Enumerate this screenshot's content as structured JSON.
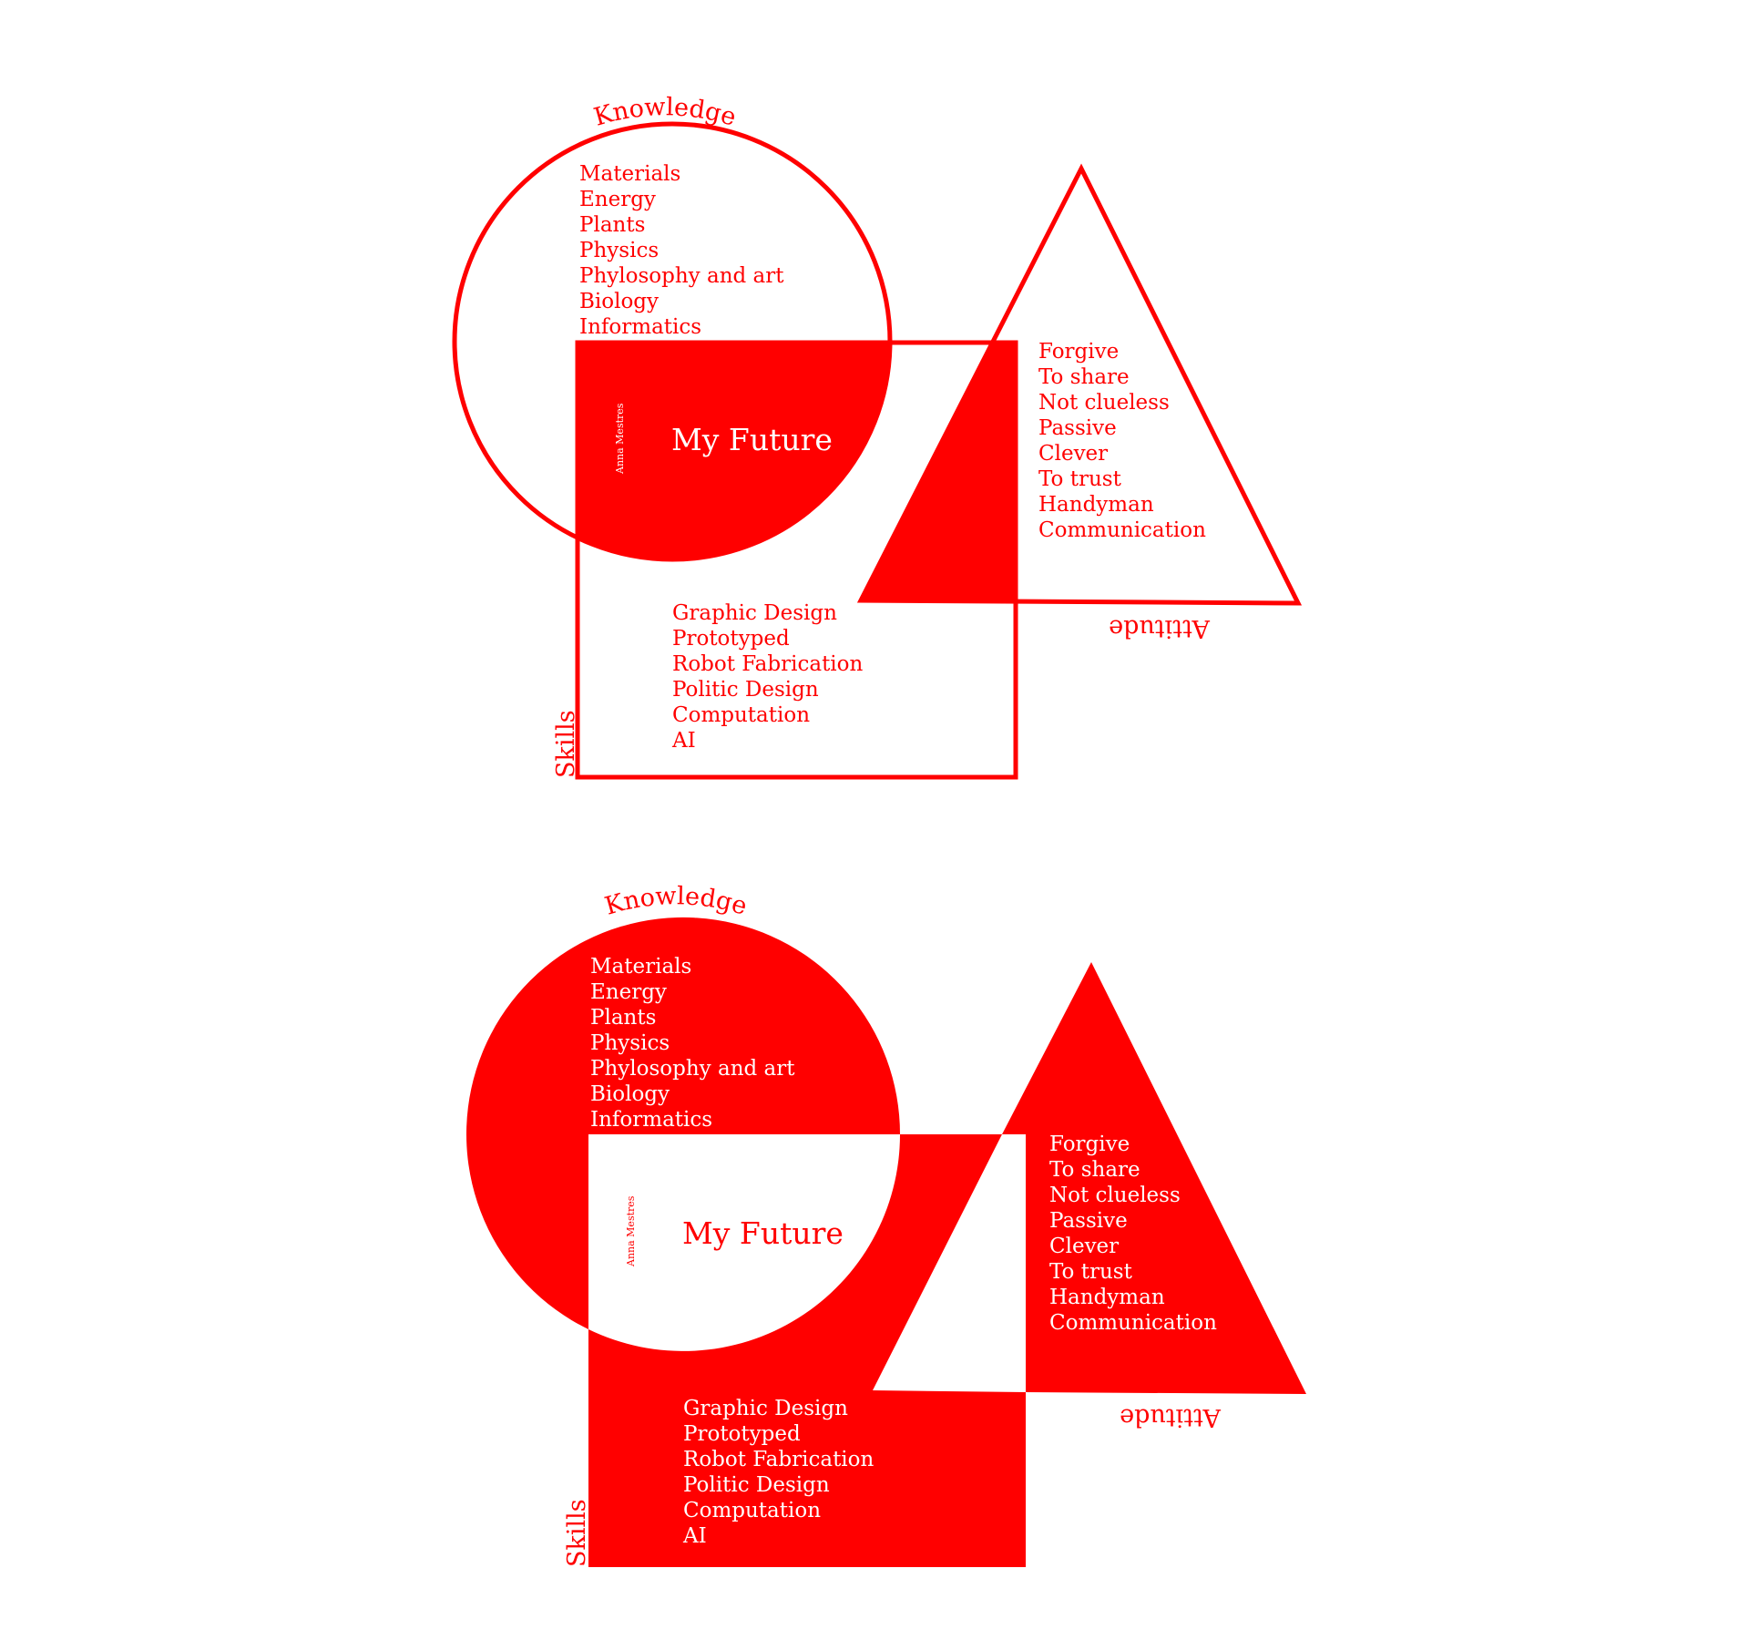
{
  "colors": {
    "accent": "#ff0000",
    "background": "#ffffff"
  },
  "titles": {
    "knowledge": "Knowledge",
    "skills": "Skills",
    "attitude": "Attitude",
    "center": "My Future",
    "author": "Anna Mestres"
  },
  "knowledge_items": [
    "Materials",
    "Energy",
    "Plants",
    "Physics",
    "Phylosophy and art",
    "Biology",
    "Informatics"
  ],
  "attitude_items": [
    "Forgive",
    "To share",
    "Not clueless",
    "Passive",
    "Clever",
    "To trust",
    "Handyman",
    "Communication"
  ],
  "skills_items": [
    "Graphic Design",
    "Prototyped",
    "Robot Fabrication",
    "Politic Design",
    "Computation",
    "AI"
  ]
}
